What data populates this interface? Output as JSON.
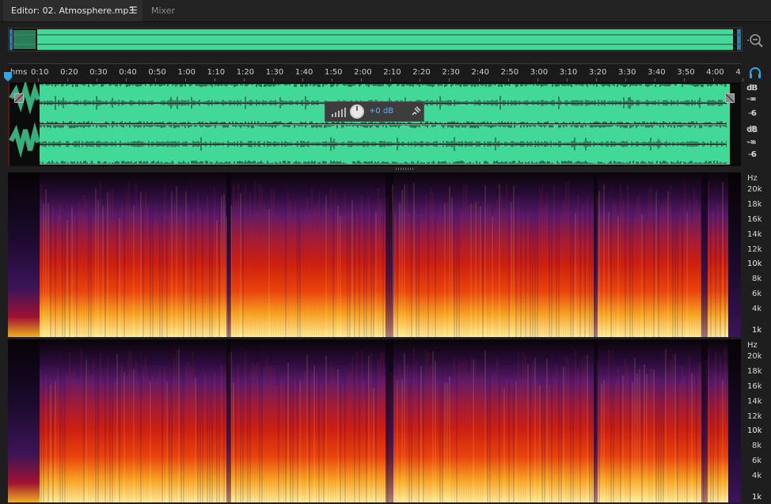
{
  "tabs": {
    "editor_label": "Editor: 02. Atmosphere.mp3",
    "menu_glyph": "☰",
    "mixer_label": "Mixer"
  },
  "ruler": {
    "unit": "hms",
    "labels": [
      "0:10",
      "0:20",
      "0:30",
      "0:40",
      "0:50",
      "1:00",
      "1:10",
      "1:20",
      "1:30",
      "1:40",
      "1:50",
      "2:00",
      "2:10",
      "2:20",
      "2:30",
      "2:40",
      "2:50",
      "3:00",
      "3:10",
      "3:20",
      "3:30",
      "3:40",
      "3:50",
      "4:00",
      "4"
    ]
  },
  "waveform": {
    "ch1": {
      "db": "dB",
      "inf": "-∞",
      "minus6": "-6"
    },
    "ch2": {
      "db": "dB",
      "inf": "-∞",
      "minus6": "-6"
    }
  },
  "hud": {
    "volume": "+0 dB"
  },
  "spectral": {
    "unit": "Hz",
    "scale": [
      "20k",
      "18k",
      "16k",
      "14k",
      "12k",
      "10k",
      "8k",
      "6k",
      "4k",
      "1k"
    ]
  },
  "colors": {
    "waveform_fill": "#41d898",
    "accent": "#2aa7e8"
  }
}
